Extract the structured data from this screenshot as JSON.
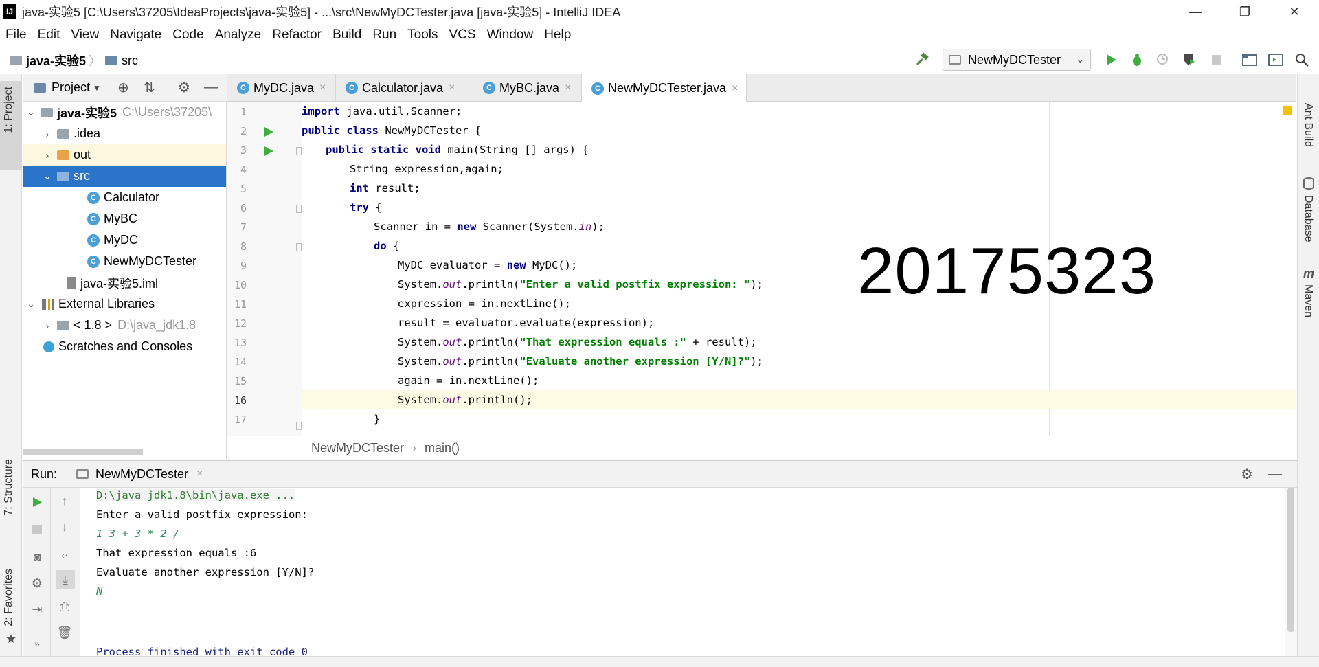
{
  "window": {
    "title": "java-实验5 [C:\\Users\\37205\\IdeaProjects\\java-实验5] - ...\\src\\NewMyDCTester.java [java-实验5] - IntelliJ IDEA",
    "logo": "IJ",
    "minimize": "—",
    "restore": "❐",
    "close": "✕"
  },
  "menu": [
    "File",
    "Edit",
    "View",
    "Navigate",
    "Code",
    "Analyze",
    "Refactor",
    "Build",
    "Run",
    "Tools",
    "VCS",
    "Window",
    "Help"
  ],
  "breadcrumb": {
    "project": "java-实验5",
    "sep": "〉",
    "folder": "src"
  },
  "toolbar": {
    "run_config": "NewMyDCTester"
  },
  "project_panel": {
    "title": "Project",
    "tree": [
      {
        "label": "java-实验5",
        "extra": "C:\\Users\\37205\\",
        "arrow": "⌄"
      },
      {
        "label": ".idea",
        "arrow": "›"
      },
      {
        "label": "out",
        "arrow": "›"
      },
      {
        "label": "src",
        "arrow": "⌄"
      },
      {
        "label": "Calculator"
      },
      {
        "label": "MyBC"
      },
      {
        "label": "MyDC"
      },
      {
        "label": "NewMyDCTester"
      },
      {
        "label": "java-实验5.iml"
      },
      {
        "label": "External Libraries",
        "arrow": "⌄"
      },
      {
        "label": "< 1.8 >",
        "extra": "D:\\java_jdk1.8",
        "arrow": "›"
      },
      {
        "label": "Scratches and Consoles"
      }
    ]
  },
  "editor_tabs": [
    {
      "label": "MyDC.java",
      "close": "×"
    },
    {
      "label": "Calculator.java",
      "close": "×"
    },
    {
      "label": "MyBC.java",
      "close": "×"
    },
    {
      "label": "NewMyDCTester.java",
      "close": "×"
    }
  ],
  "code_lines": [
    "1",
    "2",
    "3",
    "4",
    "5",
    "6",
    "7",
    "8",
    "9",
    "10",
    "11",
    "12",
    "13",
    "14",
    "15",
    "16",
    "17"
  ],
  "code": {
    "l1_kw": "import",
    "l1_rest": " java.util.Scanner;",
    "l2_kw": "public class",
    "l2_rest": " NewMyDCTester {",
    "l3_kw": "public static void",
    "l3_rest": " main(String [] args) {",
    "l4": "String expression,again;",
    "l5_kw": "int",
    "l5_rest": " result;",
    "l6_kw": "try",
    "l6_rest": " {",
    "l7_a": "Scanner in = ",
    "l7_kw": "new",
    "l7_b": " Scanner(System.",
    "l7_fld": "in",
    "l7_c": ");",
    "l8_kw": "do",
    "l8_rest": " {",
    "l9_a": "MyDC evaluator = ",
    "l9_kw": "new",
    "l9_b": " MyDC();",
    "l10_a": "System.",
    "l10_fld": "out",
    "l10_b": ".println(",
    "l10_str": "\"Enter a valid postfix expression: \"",
    "l10_c": ");",
    "l11": "expression = in.nextLine();",
    "l12": "result = evaluator.evaluate(expression);",
    "l13_a": "System.",
    "l13_fld": "out",
    "l13_b": ".println(",
    "l13_str": "\"That expression equals :\"",
    "l13_c": " + result);",
    "l14_a": "System.",
    "l14_fld": "out",
    "l14_b": ".println(",
    "l14_str": "\"Evaluate another expression [Y/N]?\"",
    "l14_c": ");",
    "l15": "again = in.nextLine();",
    "l16_a": "System.",
    "l16_fld": "out",
    "l16_b": ".println();",
    "l17": "}"
  },
  "watermark": "20175323",
  "editor_breadcrumb": {
    "cls": "NewMyDCTester",
    "sep": "›",
    "method": "main()"
  },
  "run_panel": {
    "label": "Run:",
    "tab": "NewMyDCTester",
    "close": "×",
    "console": [
      "D:\\java_jdk1.8\\bin\\java.exe ...",
      "Enter a valid postfix expression:",
      "1 3 + 3 * 2 /",
      "That expression equals :6",
      "Evaluate another expression [Y/N]?",
      "N",
      "Process finished with exit code 0"
    ]
  },
  "side_tabs": {
    "left": [
      "1: Project",
      "7: Structure",
      "2: Favorites"
    ],
    "right": [
      "Ant Build",
      "Database",
      "Maven"
    ]
  },
  "colors": {
    "selection": "#2a75c9",
    "keyword": "#000080",
    "string": "#008000",
    "field": "#660e7a",
    "run_green": "#3fae3f"
  }
}
